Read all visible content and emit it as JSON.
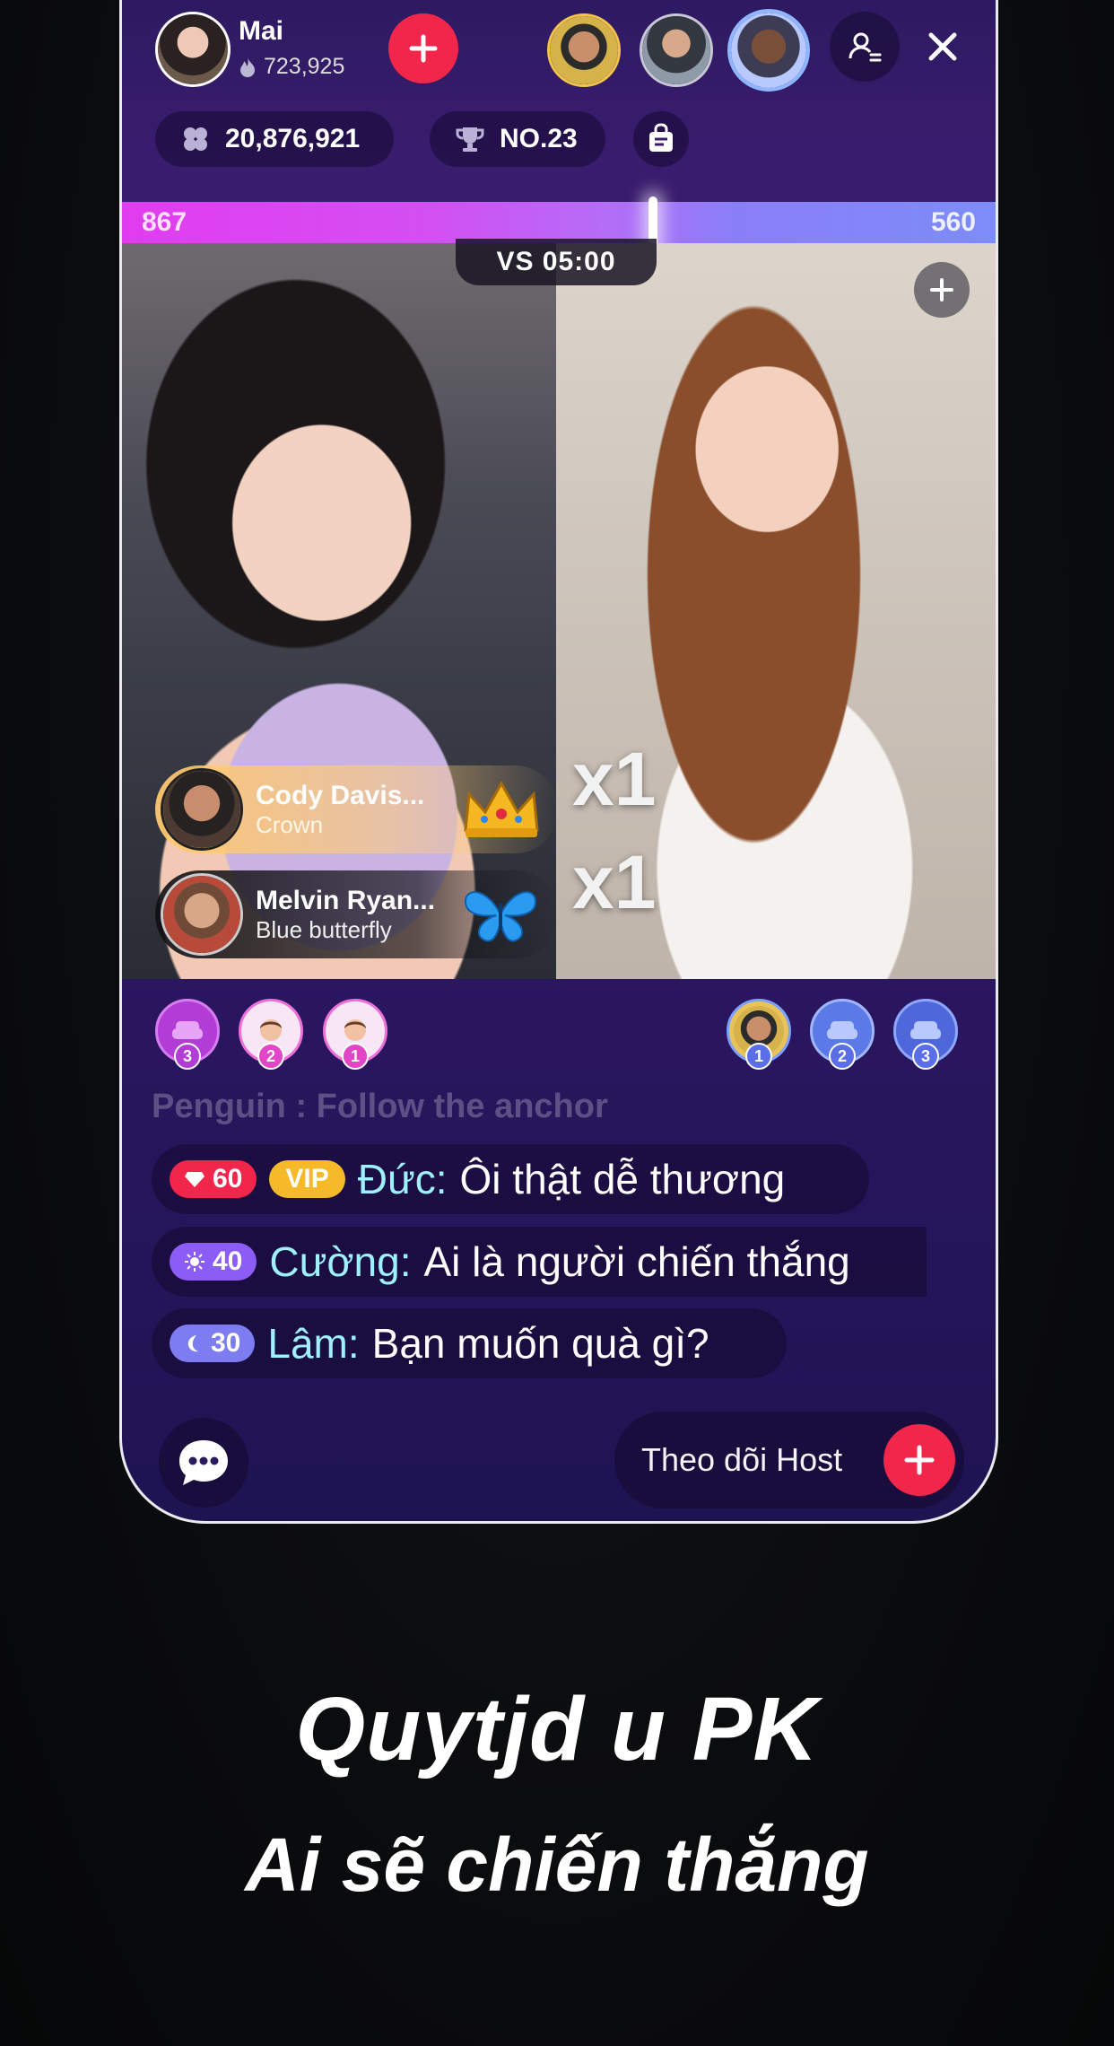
{
  "host": {
    "name": "Mai",
    "score": "723,925"
  },
  "stats": {
    "coins": "20,876,921",
    "rank": "NO.23"
  },
  "pk": {
    "left_score": "867",
    "right_score": "560",
    "timer": "VS 05:00",
    "left_share": 0.608
  },
  "gifts": [
    {
      "user": "Cody Davis...",
      "gift": "Crown",
      "multiplier": "x1"
    },
    {
      "user": "Melvin Ryan...",
      "gift": "Blue butterfly",
      "multiplier": "x1"
    }
  ],
  "left_seats": [
    "3",
    "2",
    "1"
  ],
  "right_seats": [
    "1",
    "2",
    "3"
  ],
  "chat": {
    "faded": "Penguin : Follow the anchor",
    "messages": [
      {
        "level": "60",
        "vip": "VIP",
        "user": "Đức:",
        "text": "Ôi thật dễ thương"
      },
      {
        "level": "40",
        "user": "Cường:",
        "text": "Ai là người chiến thắng"
      },
      {
        "level": "30",
        "user": "Lâm:",
        "text": "Bạn muốn quà gì?"
      }
    ]
  },
  "follow": {
    "label": "Theo dõi Host"
  },
  "caption": {
    "line1": "Quytjd u PK",
    "line2": "Ai sẽ chiến thắng"
  },
  "colors": {
    "accent_red": "#f2254a",
    "pk_pink": "#e23cf0",
    "pk_blue": "#7d8cf8",
    "cyan_name": "#9ff0ff",
    "vip_gold": "#f6b92a"
  },
  "icons": [
    "flame-icon",
    "plus-icon",
    "user-settings-icon",
    "close-icon",
    "clover-icon",
    "trophy-icon",
    "shop-bag-icon",
    "crown-icon",
    "butterfly-icon",
    "sofa-icon",
    "gem-icon",
    "sun-icon",
    "moon-icon",
    "chat-bubble-icon"
  ]
}
